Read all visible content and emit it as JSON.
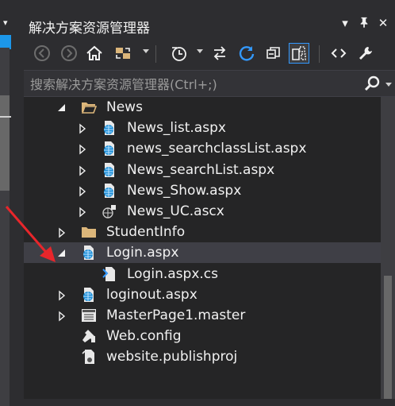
{
  "panel": {
    "title": "解决方案资源管理器",
    "title_controls": {
      "dropdown": "▾",
      "pin": "📌",
      "close": "✕"
    }
  },
  "toolbar": {
    "buttons": [
      {
        "name": "back-button",
        "icon": "back-icon"
      },
      {
        "name": "forward-button",
        "icon": "forward-icon"
      },
      {
        "name": "home-button",
        "icon": "home-icon"
      },
      {
        "name": "sync-with-document-button",
        "icon": "sync-doc-icon"
      },
      {
        "name": "pending-changes-filter-button",
        "icon": "clock-icon"
      },
      {
        "name": "sync-button",
        "icon": "swap-arrows-icon"
      },
      {
        "name": "refresh-button",
        "icon": "refresh-icon"
      },
      {
        "name": "collapse-all-button",
        "icon": "collapse-icon"
      },
      {
        "name": "show-all-files-button",
        "icon": "show-all-files-icon"
      },
      {
        "name": "view-code-button",
        "icon": "code-icon"
      },
      {
        "name": "properties-button",
        "icon": "wrench-icon"
      }
    ]
  },
  "search": {
    "placeholder": "搜索解决方案资源管理器(Ctrl+;)"
  },
  "tree": {
    "items": [
      {
        "label": "News",
        "type": "folder-open",
        "depth": 1,
        "expander": "expanded"
      },
      {
        "label": "News_list.aspx",
        "type": "aspx",
        "depth": 2,
        "expander": "collapsed"
      },
      {
        "label": "news_searchclassList.aspx",
        "type": "aspx",
        "depth": 2,
        "expander": "collapsed"
      },
      {
        "label": "News_searchList.aspx",
        "type": "aspx",
        "depth": 2,
        "expander": "collapsed"
      },
      {
        "label": "News_Show.aspx",
        "type": "aspx",
        "depth": 2,
        "expander": "collapsed"
      },
      {
        "label": "News_UC.ascx",
        "type": "ascx",
        "depth": 2,
        "expander": "collapsed"
      },
      {
        "label": "StudentInfo",
        "type": "folder",
        "depth": 1,
        "expander": "collapsed"
      },
      {
        "label": "Login.aspx",
        "type": "aspx",
        "depth": 1,
        "expander": "expanded",
        "selected": true
      },
      {
        "label": "Login.aspx.cs",
        "type": "cs",
        "depth": 2,
        "expander": "none"
      },
      {
        "label": "loginout.aspx",
        "type": "aspx",
        "depth": 1,
        "expander": "collapsed"
      },
      {
        "label": "MasterPage1.master",
        "type": "master",
        "depth": 1,
        "expander": "collapsed"
      },
      {
        "label": "Web.config",
        "type": "config",
        "depth": 1,
        "expander": "none"
      },
      {
        "label": "website.publishproj",
        "type": "publishproj",
        "depth": 1,
        "expander": "none"
      }
    ]
  },
  "colors": {
    "accent": "#3399ff",
    "background": "#252526",
    "selection": "#3f3f46",
    "folder": "#dcb67a",
    "annotation_arrow": "#e8262b"
  }
}
